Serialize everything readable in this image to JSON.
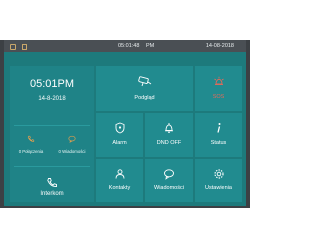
{
  "statusbar": {
    "time": "05:01:48",
    "ampm": "PM",
    "date": "14-08-2018"
  },
  "left": {
    "clock": "05:01PM",
    "date": "14-8-2018",
    "calls_label": "0 Połączenia",
    "messages_label": "0 Wiadomości",
    "interkom_label": "Interkom"
  },
  "tiles": {
    "podglad": "Podgląd",
    "sos": "SOS",
    "alarm": "Alarm",
    "dnd": "DND OFF",
    "status": "Status",
    "kontakty": "Kontakty",
    "wiadomosci": "Wiadomości",
    "ustawienia": "Ustawienia"
  },
  "colors": {
    "screen": "#1d7a7c",
    "tile": "#218b8f",
    "accent": "#e8a04c",
    "sos": "#e26a5a"
  }
}
